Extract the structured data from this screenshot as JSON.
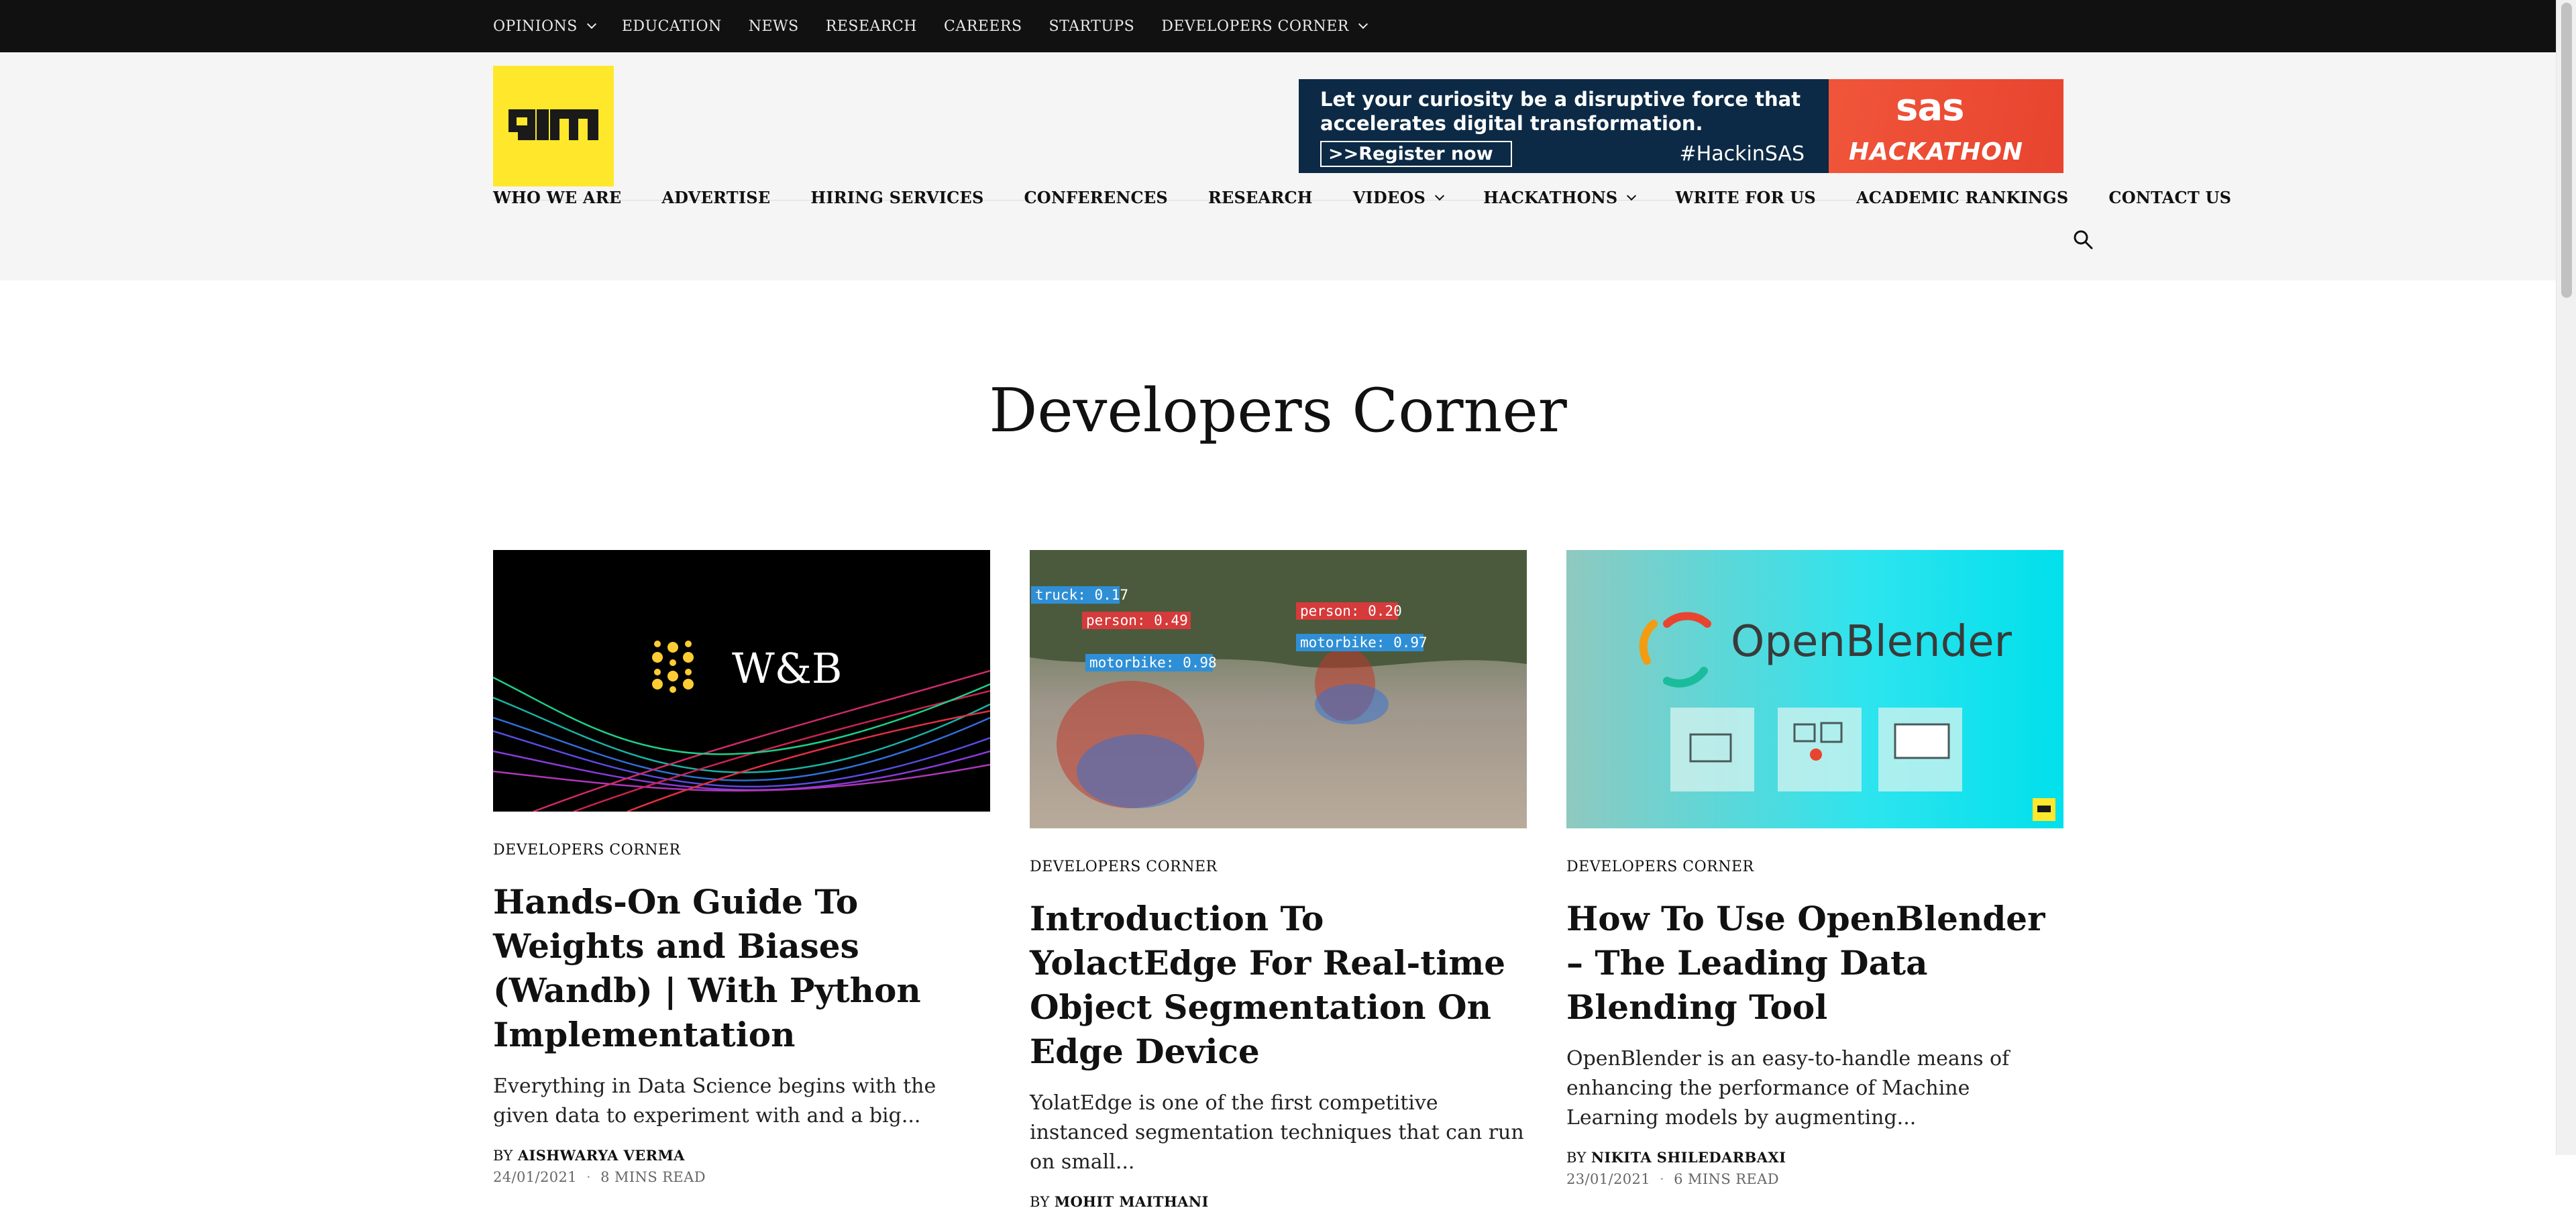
{
  "topnav": {
    "items": [
      {
        "label": "OPINIONS",
        "dropdown": true
      },
      {
        "label": "EDUCATION"
      },
      {
        "label": "NEWS"
      },
      {
        "label": "RESEARCH"
      },
      {
        "label": "CAREERS"
      },
      {
        "label": "STARTUPS"
      },
      {
        "label": "DEVELOPERS CORNER",
        "dropdown": true
      }
    ]
  },
  "header": {
    "logo_text": "AIM",
    "ad": {
      "text": "Let your curiosity be a disruptive force that accelerates digital transformation.",
      "button": ">>Register now",
      "hashtag": "#HackinSAS",
      "brand": "sas",
      "brand_sub": "HACKATHON"
    }
  },
  "mainnav": {
    "items": [
      {
        "label": "WHO WE ARE"
      },
      {
        "label": "ADVERTISE"
      },
      {
        "label": "HIRING SERVICES"
      },
      {
        "label": "CONFERENCES"
      },
      {
        "label": "RESEARCH"
      },
      {
        "label": "VIDEOS",
        "dropdown": true
      },
      {
        "label": "HACKATHONS",
        "dropdown": true
      },
      {
        "label": "WRITE FOR US"
      },
      {
        "label": "ACADEMIC RANKINGS"
      },
      {
        "label": "CONTACT US"
      }
    ]
  },
  "page": {
    "title": "Developers Corner"
  },
  "cards": [
    {
      "image_caption": "W&B",
      "category": "DEVELOPERS CORNER",
      "title": "Hands-On Guide To Weights and Biases (Wandb) | With Python Implementation",
      "excerpt": "Everything in Data Science begins with the given data to experiment with and a big...",
      "by": "BY",
      "author": "AISHWARYA VERMA",
      "date": "24/01/2021",
      "read": "8 MINS READ"
    },
    {
      "image_labels": [
        "truck: 0.17",
        "person: 0.49",
        "person: 0.20",
        "motorbike: 0.98",
        "motorbike: 0.97"
      ],
      "category": "DEVELOPERS CORNER",
      "title": "Introduction To YolactEdge For Real-time Object Segmentation On Edge Device",
      "excerpt": "YolatEdge is one of the first competitive instanced segmentation techniques that can run on small...",
      "by": "BY",
      "author": "MOHIT MAITHANI"
    },
    {
      "image_caption": "OpenBlender",
      "category": "DEVELOPERS CORNER",
      "title": "How To Use OpenBlender – The Leading Data Blending Tool",
      "excerpt": "OpenBlender is an easy-to-handle means of enhancing the performance of Machine Learning models by augmenting...",
      "by": "BY",
      "author": "NIKITA SHILEDARBAXI",
      "date": "23/01/2021",
      "read": "6 MINS READ"
    }
  ],
  "colors": {
    "topbar": "#111111",
    "header_bg": "#f5f5f5",
    "logo_yellow": "#ffe82b",
    "ad_navy": "#0c2a45",
    "ad_orange": "#e8442f",
    "openblender_teal": "#00e0ec"
  }
}
